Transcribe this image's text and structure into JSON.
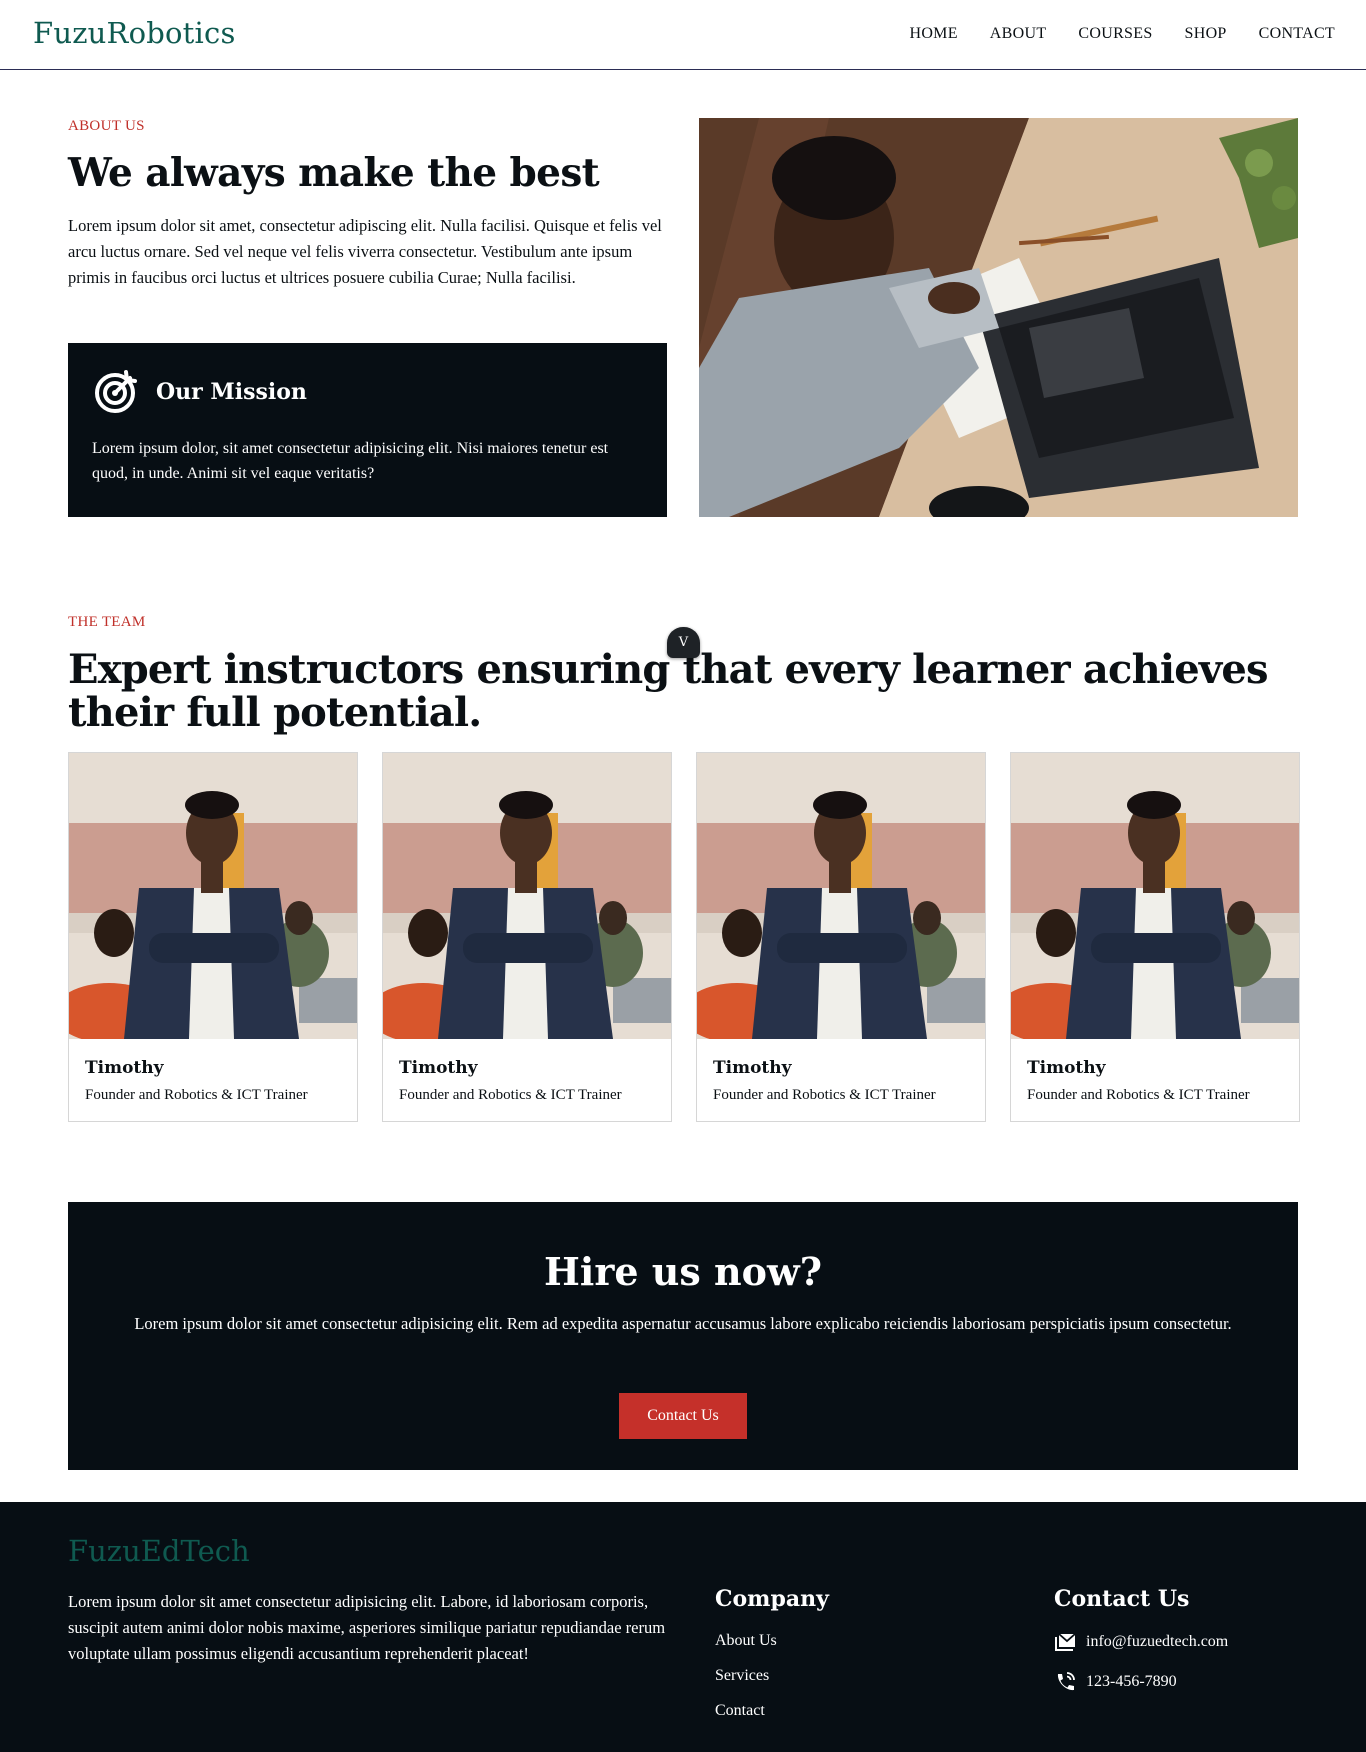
{
  "header": {
    "logo": "FuzuRobotics",
    "nav": [
      "HOME",
      "ABOUT",
      "COURSES",
      "SHOP",
      "CONTACT"
    ]
  },
  "about": {
    "eyebrow": "ABOUT US",
    "title": "We always make the best",
    "text": "Lorem ipsum dolor sit amet, consectetur adipiscing elit. Nulla facilisi. Quisque et felis vel arcu luctus ornare. Sed vel neque vel felis viverra consectetur. Vestibulum ante ipsum primis in faucibus orci luctus et ultrices posuere cubilia Curae; Nulla facilisi.",
    "mission": {
      "icon": "target-icon",
      "title": "Our Mission",
      "text": "Lorem ipsum dolor, sit amet consectetur adipisicing elit. Nisi maiores tenetur est quod, in unde. Animi sit vel eaque veritatis?"
    }
  },
  "team": {
    "eyebrow": "THE TEAM",
    "title": "Expert instructors ensuring that every learner achieves their full potential.",
    "badge": "V",
    "members": [
      {
        "name": "Timothy",
        "role": "Founder and Robotics & ICT Trainer"
      },
      {
        "name": "Timothy",
        "role": "Founder and Robotics & ICT Trainer"
      },
      {
        "name": "Timothy",
        "role": "Founder and Robotics & ICT Trainer"
      },
      {
        "name": "Timothy",
        "role": "Founder and Robotics & ICT Trainer"
      }
    ]
  },
  "hire": {
    "title": "Hire us now?",
    "text": "Lorem ipsum dolor sit amet consectetur adipisicing elit. Rem ad expedita aspernatur accusamus labore explicabo reiciendis laboriosam perspiciatis ipsum consectetur.",
    "button": "Contact Us"
  },
  "footer": {
    "brand": "FuzuEdTech",
    "text": "Lorem ipsum dolor sit amet consectetur adipisicing elit. Labore, id laboriosam corporis, suscipit autem animi dolor nobis maxime, asperiores similique pariatur repudiandae rerum voluptate ullam possimus eligendi accusantium reprehenderit placeat!",
    "company_title": "Company",
    "company_links": [
      "About Us",
      "Services",
      "Contact"
    ],
    "contact_title": "Contact Us",
    "email": "info@fuzuedtech.com",
    "phone": "123-456-7890"
  },
  "colors": {
    "brand": "#0f5a50",
    "accent": "#c5302a",
    "dark": "#070e14"
  }
}
